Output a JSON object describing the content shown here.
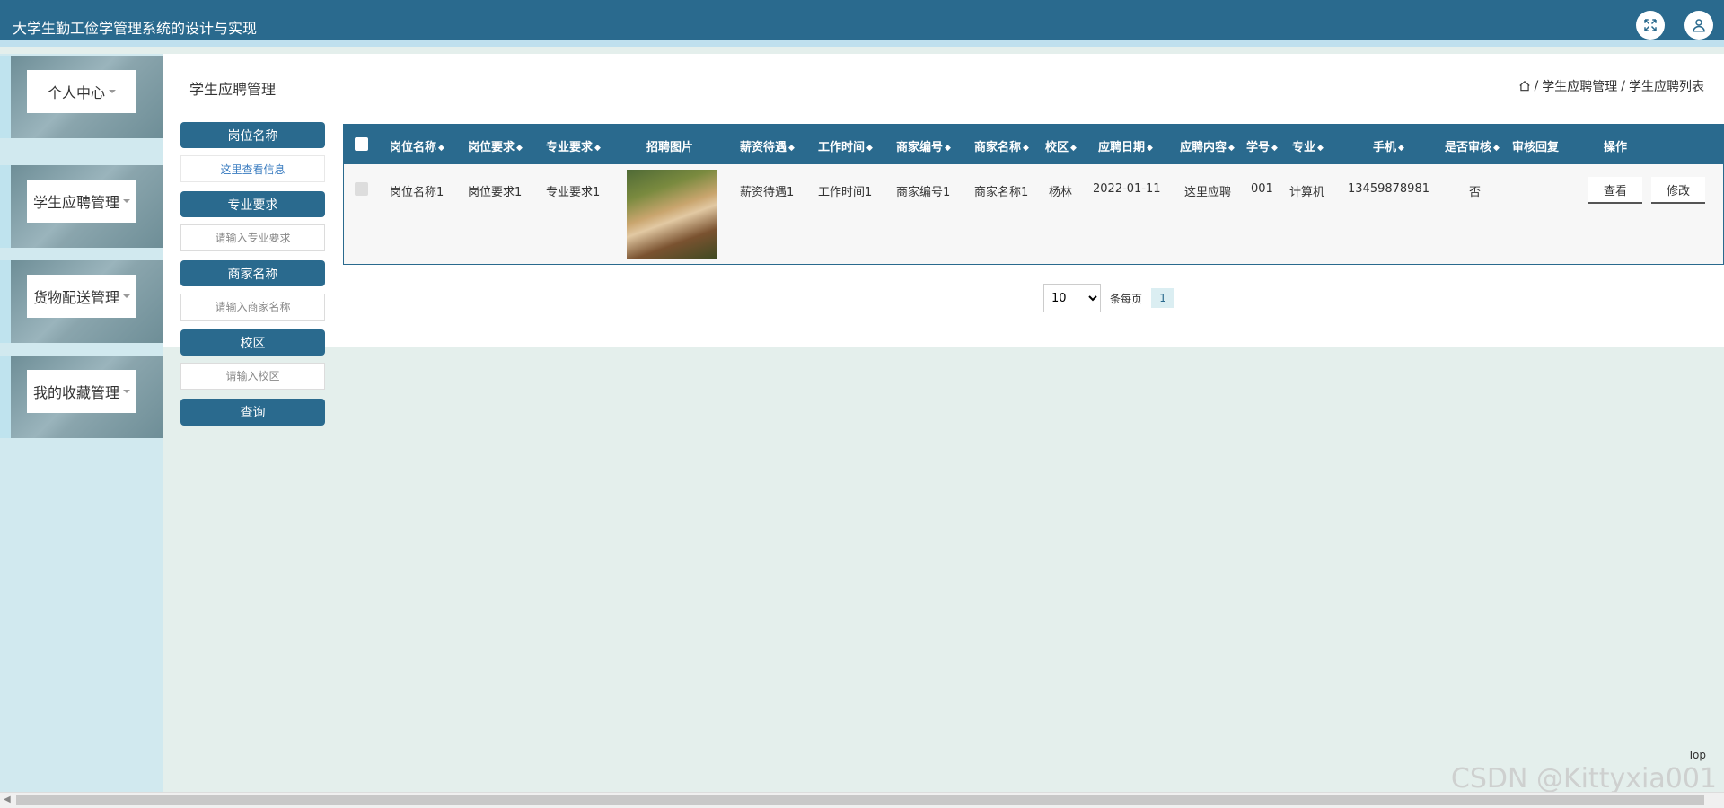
{
  "app": {
    "title": "大学生勤工俭学管理系统的设计与实现"
  },
  "topbar": {
    "fullscreen_icon": "fullscreen-icon",
    "user_icon": "user-icon"
  },
  "sidebar": {
    "items": [
      {
        "label": "个人中心"
      },
      {
        "label": "学生应聘管理"
      },
      {
        "label": "货物配送管理"
      },
      {
        "label": "我的收藏管理"
      }
    ]
  },
  "page": {
    "title": "学生应聘管理",
    "breadcrumb": {
      "level1": "学生应聘管理",
      "sep": "/",
      "level2": "学生应聘列表"
    }
  },
  "search": {
    "fields": [
      {
        "label": "岗位名称",
        "value": "这里查看信息",
        "placeholder": ""
      },
      {
        "label": "专业要求",
        "value": "",
        "placeholder": "请输入专业要求"
      },
      {
        "label": "商家名称",
        "value": "",
        "placeholder": "请输入商家名称"
      },
      {
        "label": "校区",
        "value": "",
        "placeholder": "请输入校区"
      }
    ],
    "button": "查询"
  },
  "table": {
    "headers": [
      "岗位名称",
      "岗位要求",
      "专业要求",
      "招聘图片",
      "薪资待遇",
      "工作时间",
      "商家编号",
      "商家名称",
      "校区",
      "应聘日期",
      "应聘内容",
      "学号",
      "专业",
      "手机",
      "是否审核",
      "审核回复",
      "操作"
    ],
    "rows": [
      {
        "cells": [
          "岗位名称1",
          "岗位要求1",
          "专业要求1",
          "",
          "薪资待遇1",
          "工作时间1",
          "商家编号1",
          "商家名称1",
          "杨林",
          "2022-01-11",
          "这里应聘",
          "001",
          "计算机",
          "13459878981",
          "否",
          ""
        ],
        "actions": [
          "查看",
          "修改"
        ]
      }
    ]
  },
  "pagination": {
    "page_size": "10",
    "per_page_label": "条每页",
    "current_page": "1"
  },
  "misc": {
    "top_link": "Top",
    "watermark": "CSDN @Kittyxia001"
  }
}
